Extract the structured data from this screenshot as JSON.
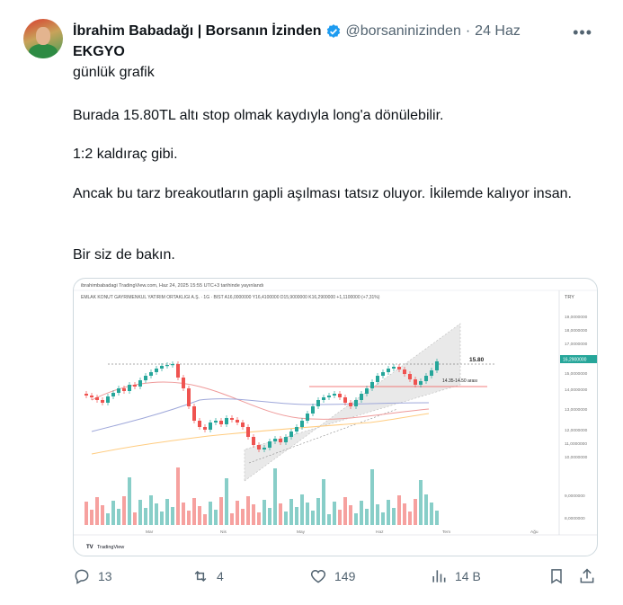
{
  "author": {
    "name": "İbrahim Babadağı | Borsanın İzinden",
    "handle": "@borsaninizinden",
    "separator": "·",
    "date": "24 Haz"
  },
  "post": {
    "title": "EKGYO",
    "subtitle": "günlük grafik",
    "paragraphs": [
      "Burada 15.80TL altı stop olmak kaydıyla long'a dönülebilir.",
      "1:2 kaldıraç gibi.",
      "Ancak bu tarz breakoutların gapli aşılması tatsız oluyor. İkilemde kalıyor insan.",
      "Bir siz de bakın."
    ]
  },
  "chart": {
    "header": "ibrahimbabadagi TradingView.com, Haz 24, 2025 15:55 UTC+3 tarihinde yayınlandı",
    "symbol_line": "EMLAK KONUT GAYRIMENKUL YATIRIM ORTAKLIGI A.Ş. · 1G · BIST  A16,0000000  Y16,4100000  D15,9000000  K16,2900000  +1,1100000 (+7,31%)",
    "currency": "TRY",
    "price_axis": [
      "19,0000000",
      "18,0000000",
      "17,0000000",
      "16,2900000",
      "15,0000000",
      "14,0000000",
      "13,0000000",
      "12,0000000",
      "11,0000000",
      "10,0000000",
      "9,0000000",
      "8,0000000"
    ],
    "volume_axis": [
      "5,2000000",
      "4,4000000"
    ],
    "months": [
      "Mar",
      "Nis",
      "May",
      "Haz",
      "Tem",
      "Ağu"
    ],
    "level_label": "15.80",
    "zone_label": "14.35-14.50 arası",
    "brand": "TradingView",
    "colors": {
      "up": "#26a69a",
      "down": "#ef5350",
      "price_tag": "#26a69a"
    }
  },
  "stats": {
    "replies": "13",
    "reposts": "4",
    "likes": "149",
    "views": "14 B"
  }
}
